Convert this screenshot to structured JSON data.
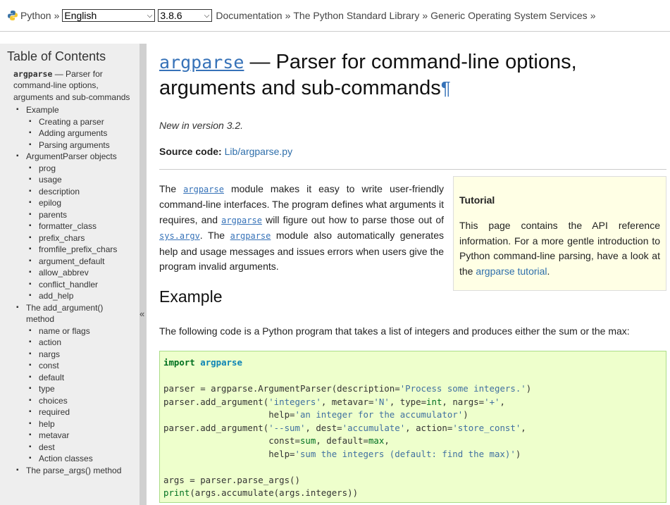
{
  "topbar": {
    "python_label": "Python",
    "sep": "»",
    "language": "English",
    "version": "3.8.6",
    "crumbs": [
      "Documentation",
      "The Python Standard Library",
      "Generic Operating System Services"
    ]
  },
  "sidebar": {
    "title": "Table of Contents",
    "top_module": "argparse",
    "top_rest": " — Parser for command-line options, arguments and sub-commands",
    "sections": [
      {
        "label": "Example",
        "children": [
          "Creating a parser",
          "Adding arguments",
          "Parsing arguments"
        ]
      },
      {
        "label": "ArgumentParser objects",
        "children": [
          "prog",
          "usage",
          "description",
          "epilog",
          "parents",
          "formatter_class",
          "prefix_chars",
          "fromfile_prefix_chars",
          "argument_default",
          "allow_abbrev",
          "conflict_handler",
          "add_help"
        ]
      },
      {
        "label": "The add_argument() method",
        "children": [
          "name or flags",
          "action",
          "nargs",
          "const",
          "default",
          "type",
          "choices",
          "required",
          "help",
          "metavar",
          "dest",
          "Action classes"
        ]
      },
      {
        "label": "The parse_args() method",
        "children": []
      }
    ],
    "collapse": "«"
  },
  "main": {
    "title_module": "argparse",
    "title_rest": " — Parser for command-line options, arguments and sub-commands",
    "pilcrow": "¶",
    "new_in": "New in version 3.2.",
    "source_label": "Source code:",
    "source_link": "Lib/argparse.py",
    "intro": [
      "The ",
      "argparse",
      " module makes it easy to write user-friendly command-line interfaces. The program defines what arguments it requires, and ",
      "argparse",
      " will figure out how to parse those out of ",
      "sys.argv",
      ". The ",
      "argparse",
      " module also automatically generates help and usage messages and issues errors when users give the program invalid arguments."
    ],
    "tutorial": {
      "title": "Tutorial",
      "text": "This page contains the API reference information. For a more gentle introduction to Python command-line parsing, have a look at the ",
      "link": "argparse tutorial",
      "end": "."
    },
    "example_heading": "Example",
    "example_text": "The following code is a Python program that takes a list of integers and produces either the sum or the max:",
    "code_lines": [
      "import argparse",
      "",
      "parser = argparse.ArgumentParser(description='Process some integers.')",
      "parser.add_argument('integers', metavar='N', type=int, nargs='+',",
      "                    help='an integer for the accumulator')",
      "parser.add_argument('--sum', dest='accumulate', action='store_const',",
      "                    const=sum, default=max,",
      "                    help='sum the integers (default: find the max)')",
      "",
      "args = parser.parse_args()",
      "print(args.accumulate(args.integers))"
    ]
  }
}
